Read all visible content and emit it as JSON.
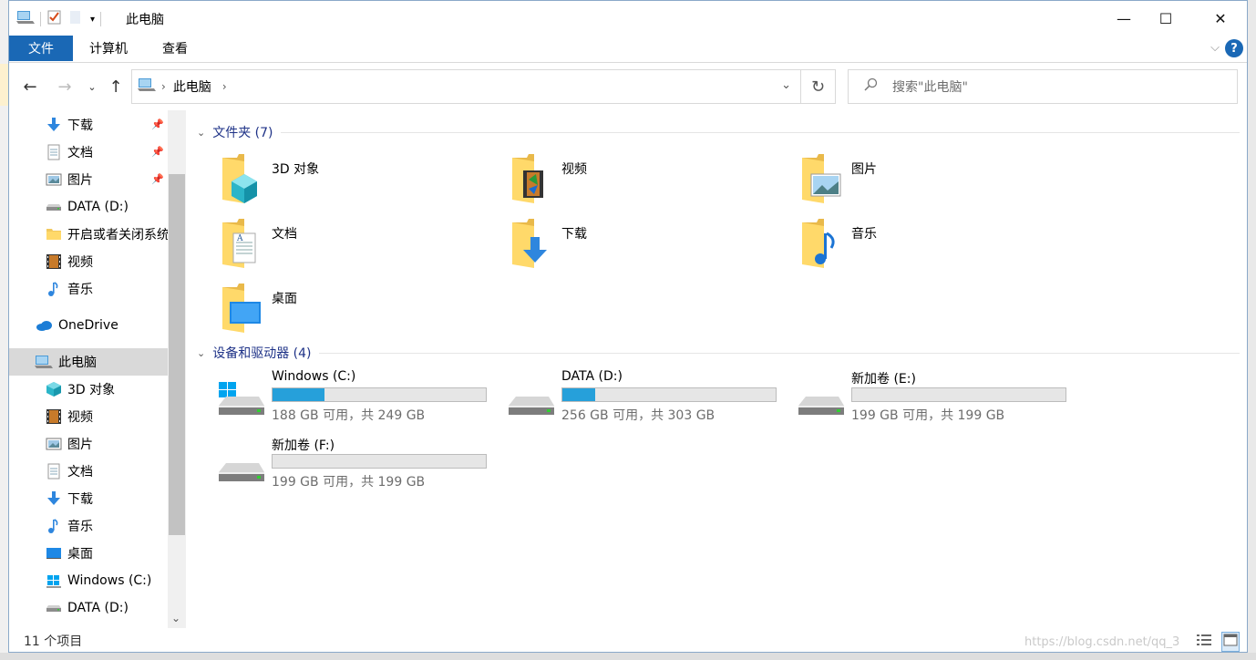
{
  "window": {
    "title": "此电脑",
    "controls": {
      "minimize": "—",
      "maximize": "☐",
      "close": "✕"
    }
  },
  "ribbon": {
    "tabs": [
      "文件",
      "计算机",
      "查看"
    ],
    "help": "?"
  },
  "nav": {
    "breadcrumb": "此电脑",
    "search_placeholder": "搜索\"此电脑\""
  },
  "sidebar": {
    "items": [
      {
        "label": "下载",
        "icon": "download-icon",
        "pinned": true
      },
      {
        "label": "文档",
        "icon": "document-icon",
        "pinned": true
      },
      {
        "label": "图片",
        "icon": "pictures-icon",
        "pinned": true
      },
      {
        "label": "DATA (D:)",
        "icon": "drive-icon",
        "pinned": false
      },
      {
        "label": "开启或者关闭系统",
        "icon": "folder-icon",
        "pinned": false
      },
      {
        "label": "视频",
        "icon": "video-icon",
        "pinned": false
      },
      {
        "label": "音乐",
        "icon": "music-icon",
        "pinned": false
      },
      {
        "label": "OneDrive",
        "icon": "onedrive-icon",
        "pinned": false
      },
      {
        "label": "此电脑",
        "icon": "this-pc-icon",
        "pinned": false,
        "selected": true
      },
      {
        "label": "3D 对象",
        "icon": "3d-objects-icon",
        "pinned": false
      },
      {
        "label": "视频",
        "icon": "video-icon",
        "pinned": false
      },
      {
        "label": "图片",
        "icon": "pictures-icon",
        "pinned": false
      },
      {
        "label": "文档",
        "icon": "document-icon",
        "pinned": false
      },
      {
        "label": "下载",
        "icon": "download-icon",
        "pinned": false
      },
      {
        "label": "音乐",
        "icon": "music-icon",
        "pinned": false
      },
      {
        "label": "桌面",
        "icon": "desktop-icon",
        "pinned": false
      },
      {
        "label": "Windows (C:)",
        "icon": "windows-drive-icon",
        "pinned": false
      },
      {
        "label": "DATA (D:)",
        "icon": "drive-icon",
        "pinned": false
      }
    ]
  },
  "main": {
    "folders_header": "文件夹 (7)",
    "folders": [
      {
        "label": "3D 对象",
        "icon": "3d-objects-folder-icon"
      },
      {
        "label": "视频",
        "icon": "video-folder-icon"
      },
      {
        "label": "图片",
        "icon": "pictures-folder-icon"
      },
      {
        "label": "文档",
        "icon": "documents-folder-icon"
      },
      {
        "label": "下载",
        "icon": "downloads-folder-icon"
      },
      {
        "label": "音乐",
        "icon": "music-folder-icon"
      },
      {
        "label": "桌面",
        "icon": "desktop-folder-icon"
      }
    ],
    "drives_header": "设备和驱动器 (4)",
    "drives": [
      {
        "name": "Windows (C:)",
        "size_text": "188 GB 可用，共 249 GB",
        "used_fraction": 0.245,
        "icon": "windows-drive-icon"
      },
      {
        "name": "DATA (D:)",
        "size_text": "256 GB 可用，共 303 GB",
        "used_fraction": 0.155,
        "icon": "drive-icon"
      },
      {
        "name": "新加卷 (E:)",
        "size_text": "199 GB 可用，共 199 GB",
        "used_fraction": 0.0,
        "icon": "drive-icon"
      },
      {
        "name": "新加卷 (F:)",
        "size_text": "199 GB 可用，共 199 GB",
        "used_fraction": 0.0,
        "icon": "drive-icon"
      }
    ]
  },
  "status": {
    "item_count": "11 个项目"
  },
  "watermark": "https://blog.csdn.net/qq_3",
  "colors": {
    "accent": "#1a68b5",
    "group_header": "#1e3287",
    "usage_bar": "#26a0da"
  }
}
